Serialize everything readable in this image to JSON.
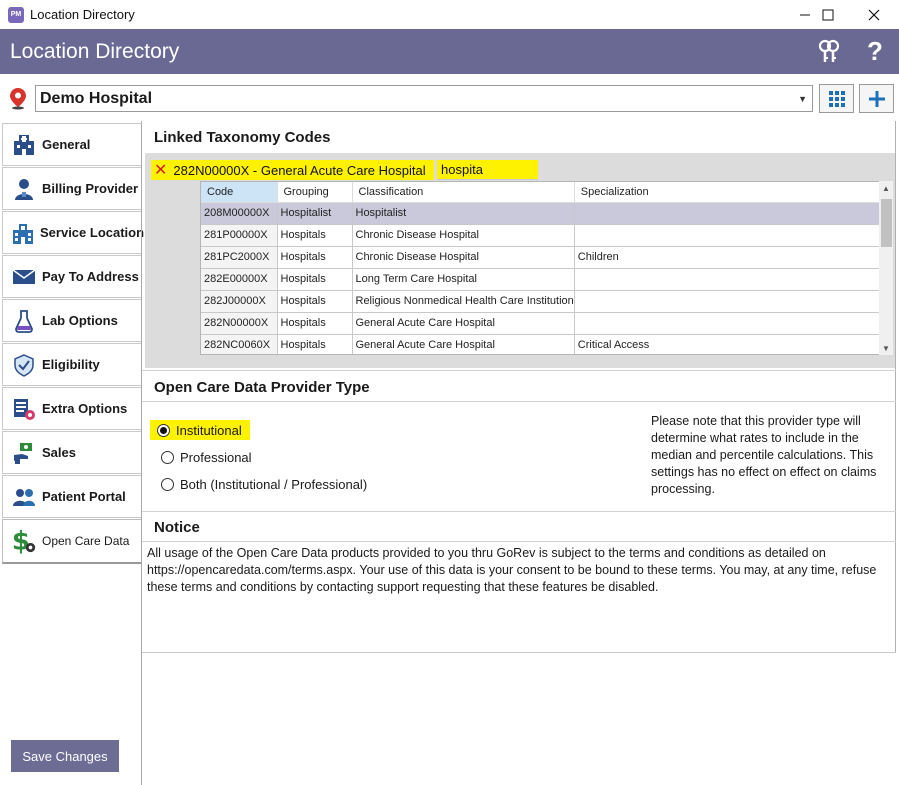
{
  "window": {
    "app_icon_text": "PM",
    "title": "Location Directory"
  },
  "header": {
    "title": "Location Directory",
    "help_label": "?"
  },
  "location": {
    "selected": "Demo Hospital"
  },
  "sidebar": {
    "items": [
      {
        "label": "General",
        "icon": "hospital-icon"
      },
      {
        "label": "Billing Provider",
        "icon": "person-icon"
      },
      {
        "label": "Service Location",
        "icon": "building-icon"
      },
      {
        "label": "Pay To Address",
        "icon": "envelope-icon"
      },
      {
        "label": "Lab Options",
        "icon": "flask-icon"
      },
      {
        "label": "Eligibility",
        "icon": "shield-check-icon"
      },
      {
        "label": "Extra Options",
        "icon": "list-gear-icon"
      },
      {
        "label": "Sales",
        "icon": "hand-money-icon"
      },
      {
        "label": "Patient Portal",
        "icon": "people-icon"
      },
      {
        "label": "Open Care Data",
        "icon": "dollar-gear-icon"
      }
    ],
    "save_label": "Save Changes"
  },
  "taxonomy": {
    "title": "Linked Taxonomy Codes",
    "token": "282N00000X - General Acute Care Hospital",
    "search_value": "hospita",
    "columns": [
      "Code",
      "Grouping",
      "Classification",
      "Specialization"
    ],
    "rows": [
      [
        "208M00000X",
        "Hospitalist",
        "Hospitalist",
        ""
      ],
      [
        "281P00000X",
        "Hospitals",
        "Chronic Disease Hospital",
        ""
      ],
      [
        "281PC2000X",
        "Hospitals",
        "Chronic Disease Hospital",
        "Children"
      ],
      [
        "282E00000X",
        "Hospitals",
        "Long Term Care Hospital",
        ""
      ],
      [
        "282J00000X",
        "Hospitals",
        "Religious Nonmedical Health Care Institution",
        ""
      ],
      [
        "282N00000X",
        "Hospitals",
        "General Acute Care Hospital",
        ""
      ],
      [
        "282NC0060X",
        "Hospitals",
        "General Acute Care Hospital",
        "Critical Access"
      ]
    ]
  },
  "provider_type": {
    "title": "Open Care Data Provider Type",
    "options": [
      {
        "label": "Institutional",
        "selected": true
      },
      {
        "label": "Professional",
        "selected": false
      },
      {
        "label": "Both (Institutional / Professional)",
        "selected": false
      }
    ],
    "note": "Please note that this provider type will determine what rates to include in the median and percentile calculations. This settings has no effect on effect on claims processing."
  },
  "notice": {
    "title": "Notice",
    "text": "All usage of the Open Care Data products provided to you thru GoRev is subject to the terms and conditions as detailed on https://opencaredata.com/terms.aspx. Your use of this data is your consent to be bound to these terms. You may, at any time, refuse these terms and conditions by contacting support requesting that these features be disabled."
  },
  "colors": {
    "header_bg": "#6a6994",
    "highlight": "#fff200",
    "token_remove": "#d21f1f",
    "accent_blue": "#1d6fb8"
  }
}
